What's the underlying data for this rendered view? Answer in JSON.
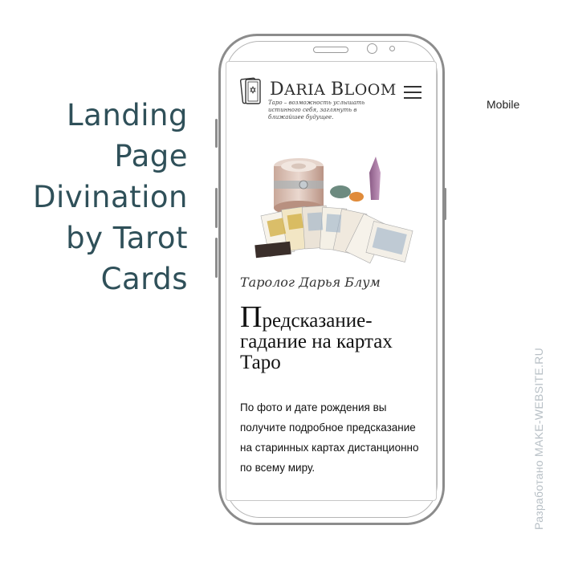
{
  "side": {
    "title_lines": [
      "Landing",
      "Page",
      "Divination",
      "by Tarot",
      "Cards"
    ],
    "mobile_label": "Mobile",
    "credit_prefix": "Разработано ",
    "credit_site": "MAKE-WEBSITE.RU"
  },
  "site": {
    "logo_first": "D",
    "logo_rest1": "ARIA ",
    "logo_second": "B",
    "logo_rest2": "LOOM",
    "tagline": "Таро – возможность услышать истинного себя, заглянуть в ближайшее будущее.",
    "tarologist": "Таролог Дарья Блум",
    "headline_cap": "П",
    "headline_rest": "редсказание-гадание на картах Таро",
    "description": "По фото и дате рождения вы получите подробное предсказание на старинных картах дистанционно по всему миру."
  },
  "icons": {
    "menu": "hamburger-menu-icon",
    "logo": "tarot-cards-logo-icon"
  }
}
